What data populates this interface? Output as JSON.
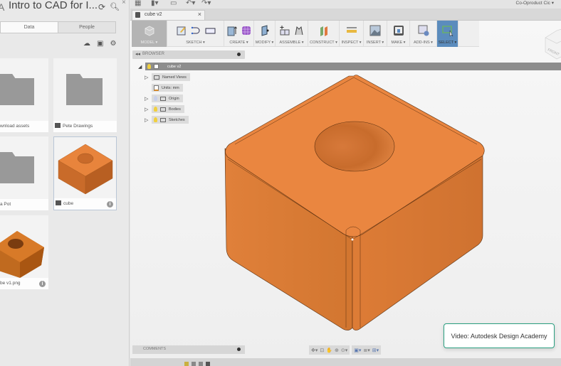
{
  "data_panel": {
    "project_title": "Intro to CAD for I...",
    "icons": {
      "refresh": "refresh-icon",
      "search": "search-icon",
      "close": "close-icon"
    },
    "tabs": [
      {
        "label": "Data",
        "active": true
      },
      {
        "label": "People",
        "active": false
      }
    ],
    "tools": [
      "upload-icon",
      "new-folder-icon",
      "gear-icon"
    ],
    "items": [
      {
        "name": "wnload assets",
        "type": "folder"
      },
      {
        "name": "Pete Drawings",
        "type": "folder"
      },
      {
        "name": "a Pot",
        "type": "folder"
      },
      {
        "name": "cube",
        "type": "design",
        "selected": true
      },
      {
        "name": "be v1.png",
        "type": "image"
      }
    ]
  },
  "app": {
    "top_icons": [
      "grid-icon",
      "file-icon",
      "save-icon",
      "undo-icon",
      "redo-icon"
    ],
    "user": "Co-Oproduct Cic",
    "document_tab": {
      "name": "cube v2"
    }
  },
  "toolbar": {
    "groups": [
      {
        "label": "MODEL ▾"
      },
      {
        "label": "SKETCH ▾"
      },
      {
        "label": "CREATE ▾"
      },
      {
        "label": "MODIFY ▾"
      },
      {
        "label": "ASSEMBLE ▾"
      },
      {
        "label": "CONSTRUCT ▾"
      },
      {
        "label": "INSPECT ▾"
      },
      {
        "label": "INSERT ▾"
      },
      {
        "label": "MAKE ▾"
      },
      {
        "label": "ADD-INS ▾"
      },
      {
        "label": "SELECT ▾"
      }
    ]
  },
  "browser": {
    "title": "BROWSER",
    "root": "cube v2",
    "nodes": [
      {
        "label": "Named Views"
      },
      {
        "label": "Units: mm"
      },
      {
        "label": "Origin"
      },
      {
        "label": "Bodies"
      },
      {
        "label": "Sketches"
      }
    ]
  },
  "comments": {
    "title": "COMMENTS"
  },
  "viewcube": {
    "face": "FRONT"
  },
  "toast": {
    "text": "Video: Autodesk Design Academy"
  },
  "colors": {
    "model": "#e8843c",
    "select_accent": "#5b8cbd",
    "toast_border": "#2a9f80"
  }
}
